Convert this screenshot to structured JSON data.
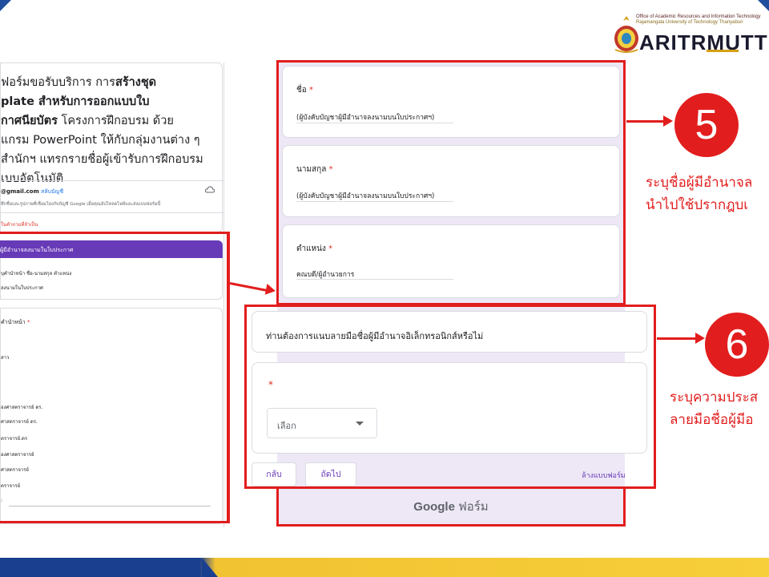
{
  "logo": {
    "office_line1": "Office of Academic Resources and Information Technology",
    "office_line2": "Rajamangala University of Technology Thanyaburi",
    "brand": "ARITRMUTT"
  },
  "left_form": {
    "title_parts": [
      {
        "text": "ฟอร์มขอรับบริการ การ",
        "bold": false
      },
      {
        "text": "สร้างชุด",
        "bold": true
      }
    ],
    "title_line1_a": "ฟอร์มขอรับบริการ การ",
    "title_line1_b": "สร้างชุด",
    "title_line2": "plate สำหรับการออกแบบใบ",
    "title_line3_a": "กาศนียบัตร",
    "title_line3_b": " โครงการฝึกอบรม ด้วย",
    "title_line4": "แกรม PowerPoint ให้กับกลุ่มงานต่าง ๆ",
    "title_line5": "สำนักฯ แทรกรายชื่อผู้เข้ารับการฝึกอบรม",
    "title_line6": "เบบอัตโนมัติ",
    "email": "@gmail.com",
    "switch_account": "สลับบัญชี",
    "note": "ทึกชื่อและรูปภาพที่เชื่อมโยงกับบัญชี Google เมื่อคุณอัปโหลดไฟล์และส่งแบบฟอร์มนี้",
    "required_note": "ในคำถามที่จำเป็น",
    "section_header": "ผู้มีอำนาจลงนามในใบประกาศ",
    "section_line1": "บุคำนำหน้า ชื่อ-นามสกุล ตำแหน่ง",
    "section_line2": "ลงนามในใบประกาศ",
    "question_label": "คำนำหน้า",
    "options": [
      "สาว",
      "องศาสตราจารย์ ดร.",
      "ศาสตราจารย์ ดร.",
      "ตราจารย์.ดร",
      "องศาสตราจารย์",
      "ศาสตราจารย์",
      "ตราจารย์",
      ":"
    ]
  },
  "form": {
    "fields": [
      {
        "label": "ชื่อ",
        "value": "(ผู้บังคับบัญชาผู้มีอำนาจลงนามบนใบประกาศฯ)"
      },
      {
        "label": "นามสกุล",
        "value": "(ผู้บังคับบัญชาผู้มีอำนาจลงนามบนใบประกาศฯ)"
      },
      {
        "label": "ตำแหน่ง",
        "value": "คณบดี/ผู้อำนวยการ"
      }
    ],
    "question_title": "ท่านต้องการแนบลายมือชื่อผู้มีอำนาจอิเล็กทรอนิกส์หรือไม่",
    "required_mark": "*",
    "select_placeholder": "เลือก",
    "back_button": "กลับ",
    "next_button": "ถัดไป",
    "clear_form": "ล้างแบบฟอร์ม",
    "footer_google": "Google",
    "footer_forms": " ฟอร์ม"
  },
  "steps": [
    {
      "number": "5",
      "caption_line1": "ระบุชื่อผู้มีอำนาจล",
      "caption_line2": "นำไปใช้ปรากฎบเ"
    },
    {
      "number": "6",
      "caption_line1": "ระบุความประส",
      "caption_line2": "ลายมือชื่อผู้มีอ"
    }
  ],
  "colors": {
    "highlight": "#e21d1d",
    "form_accent": "#673ab7",
    "form_background": "#ede7f6",
    "required": "#d93025"
  },
  "icons": [
    "cloud-icon",
    "chevron-down-icon",
    "seal-icon"
  ]
}
